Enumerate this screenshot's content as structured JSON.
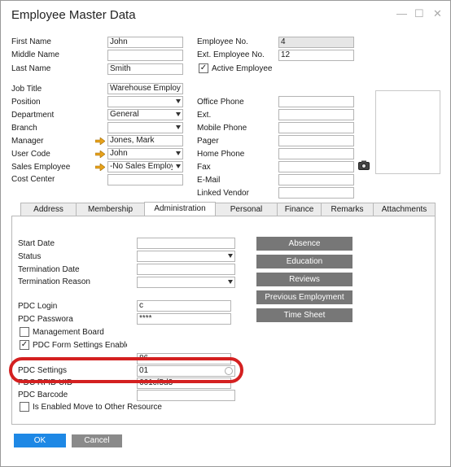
{
  "window": {
    "title": "Employee Master Data"
  },
  "header": {
    "first_name_label": "First Name",
    "first_name": "John",
    "middle_name_label": "Middle Name",
    "middle_name": "",
    "last_name_label": "Last Name",
    "last_name": "Smith",
    "employee_no_label": "Employee No.",
    "employee_no": "4",
    "ext_employee_no_label": "Ext. Employee No.",
    "ext_employee_no": "12",
    "active_employee_label": "Active Employee",
    "active_employee": true
  },
  "details": {
    "job_title_label": "Job Title",
    "job_title": "Warehouse Employ",
    "position_label": "Position",
    "position": "",
    "department_label": "Department",
    "department": "General",
    "branch_label": "Branch",
    "branch": "",
    "manager_label": "Manager",
    "manager": "Jones, Mark",
    "user_code_label": "User Code",
    "user_code": "John",
    "sales_employee_label": "Sales Employee",
    "sales_employee": "-No Sales Employ",
    "cost_center_label": "Cost Center",
    "cost_center": ""
  },
  "contact": {
    "office_phone_label": "Office Phone",
    "ext_label": "Ext.",
    "mobile_phone_label": "Mobile Phone",
    "pager_label": "Pager",
    "home_phone_label": "Home Phone",
    "fax_label": "Fax",
    "email_label": "E-Mail",
    "linked_vendor_label": "Linked Vendor"
  },
  "tabs": [
    "Address",
    "Membership",
    "Administration",
    "Personal",
    "Finance",
    "Remarks",
    "Attachments"
  ],
  "active_tab": "Administration",
  "administration": {
    "start_date_label": "Start Date",
    "start_date": "",
    "status_label": "Status",
    "status": "",
    "termination_date_label": "Termination Date",
    "termination_date": "",
    "termination_reason_label": "Termination Reason",
    "termination_reason": "",
    "pdc_login_label": "PDC Login",
    "pdc_login": "c",
    "pdc_password_label": "PDC Passwora",
    "pdc_password": "****",
    "management_board_label": "Management Board",
    "management_board": false,
    "pdc_form_settings_label": "PDC Form Settings Enable",
    "pdc_form_settings": true,
    "labor_code_value": "86",
    "pdc_settings_label": "PDC Settings",
    "pdc_settings": "01",
    "pdc_rfid_label": "PDC RFID UID",
    "pdc_rfid": "661cf5d3",
    "pdc_barcode_label": "PDC Barcode",
    "pdc_barcode": "",
    "enabled_move_label": "Is Enabled Move to Other Resource",
    "enabled_move": false,
    "buttons": [
      "Absence",
      "Education",
      "Reviews",
      "Previous Employment",
      "Time Sheet"
    ]
  },
  "footer": {
    "ok_label": "OK",
    "cancel_label": "Cancel"
  },
  "colors": {
    "ok_button": "#1e88e5",
    "gray_button": "#777777",
    "highlight_ring": "#d42020",
    "link_arrow": "#e8a21a"
  }
}
